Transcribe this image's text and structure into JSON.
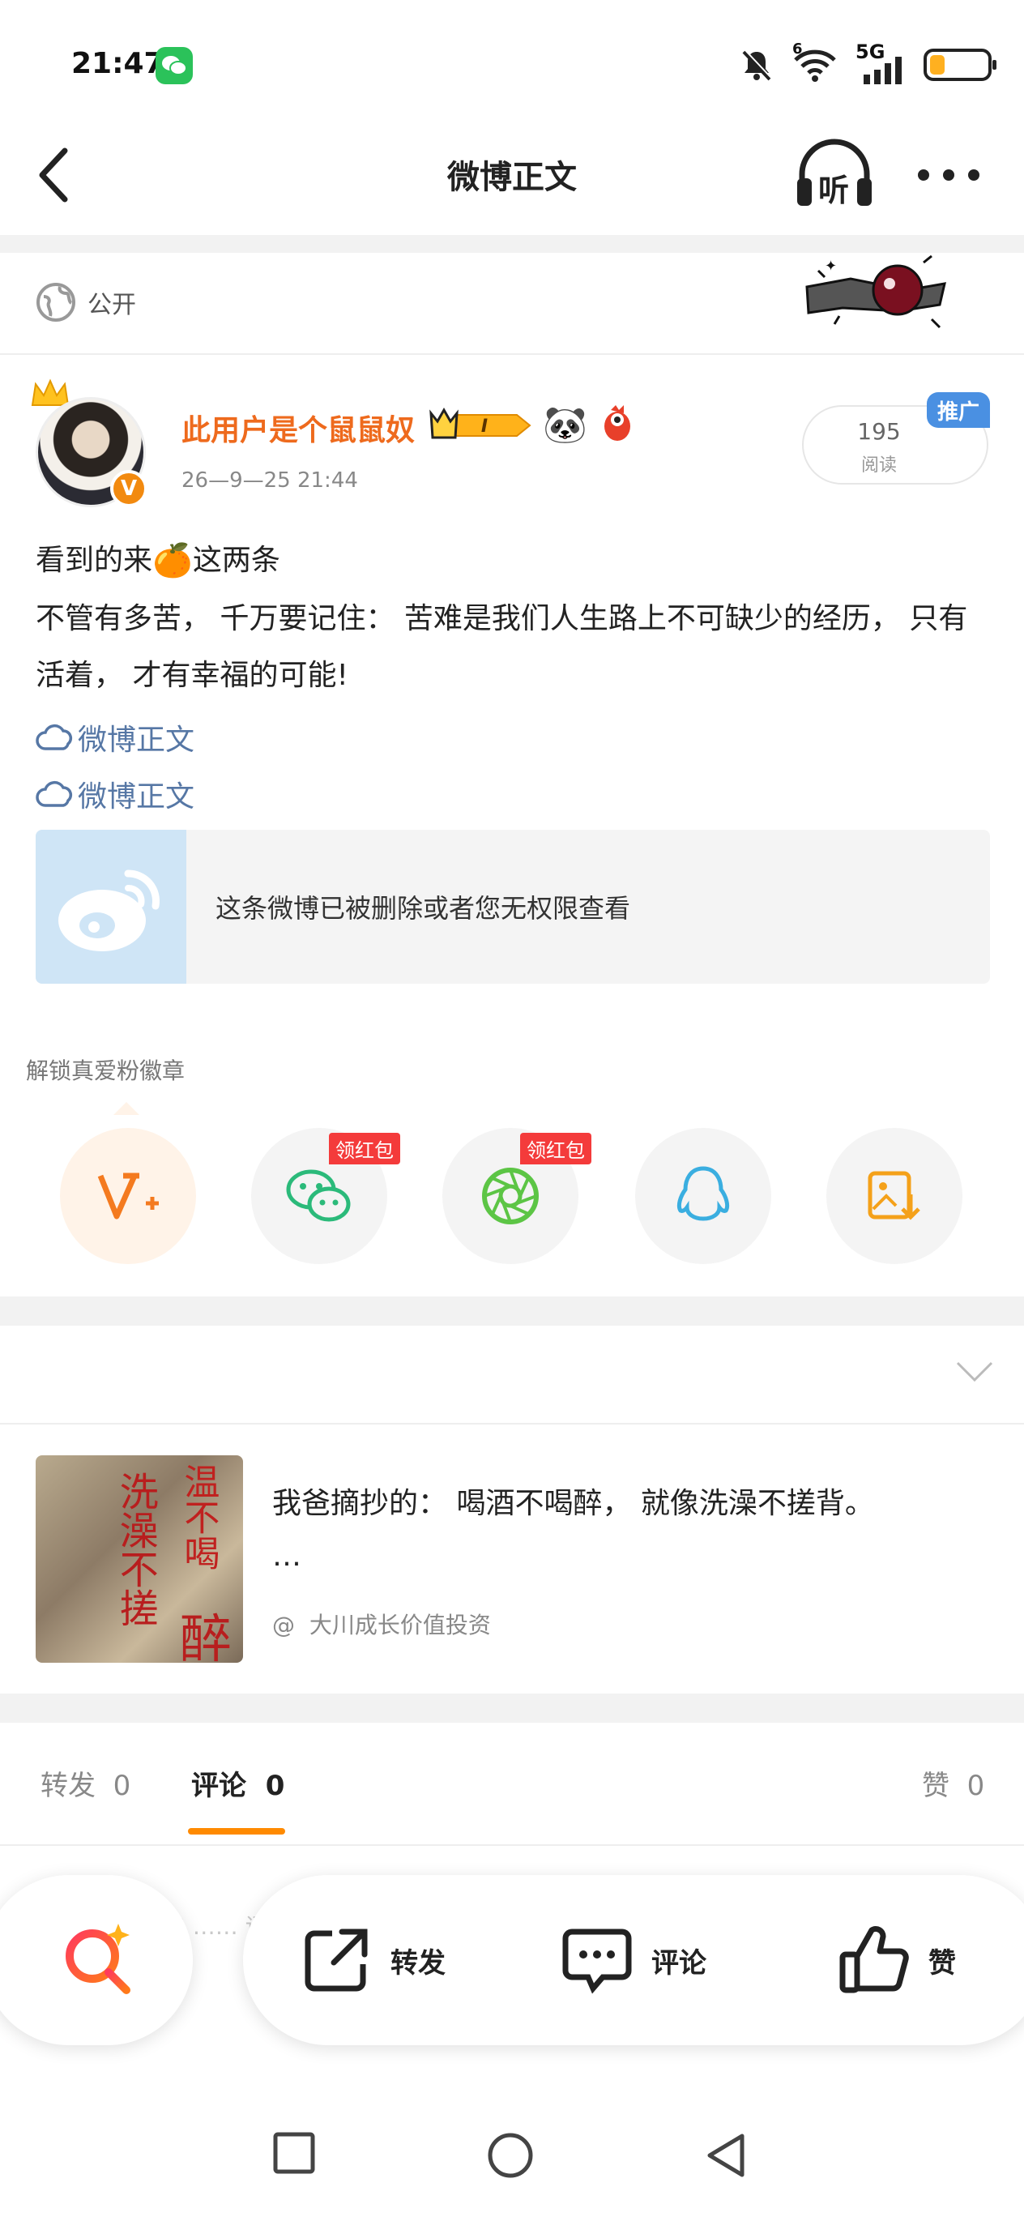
{
  "status_bar": {
    "time": "21:47",
    "network": "5G",
    "wifi_sub": "6"
  },
  "nav": {
    "title": "微博正文",
    "listen_label": "听"
  },
  "visibility": {
    "label": "公开"
  },
  "author": {
    "name": "此用户是个鼠鼠奴",
    "time": "26—9—25  21:44",
    "verified": "V",
    "level_badge": "I"
  },
  "reads": {
    "count": "195",
    "label": "阅读",
    "promo": "推广"
  },
  "post": {
    "line1_a": "看到的来",
    "line1_emoji": "🍊",
    "line1_b": "这两条",
    "line2": "不管有多苦， 千万要记住： 苦难是我们人生路上不可缺少的经历， 只有",
    "line3": "活着， 才有幸福的可能!",
    "links": [
      "微博正文",
      "微博正文"
    ]
  },
  "deleted_card": {
    "text": "这条微博已被删除或者您无权限查看"
  },
  "unlock": {
    "title": "解锁真爱粉徽章",
    "red_packet": "领红包"
  },
  "recommend": {
    "text": "我爸摘抄的： 喝酒不喝醉， 就像洗澡不搓背。",
    "ellipsis": "…",
    "at": "@",
    "author": "大川成长价值投资",
    "image_chars": [
      "温不喝",
      "洗澡不搓",
      "醉"
    ]
  },
  "tabs": {
    "repost": "转发",
    "repost_count": "0",
    "comment": "评论",
    "comment_count": "0",
    "like": "赞",
    "like_count": "0"
  },
  "hint": "…… 意攻击 …… 评论 …… 次数超",
  "actions": {
    "repost": "转发",
    "comment": "评论",
    "like": "赞"
  },
  "colors": {
    "accent": "#ff8a00",
    "name": "#ee6a1d",
    "link": "#5677a5",
    "promo": "#4a90e2",
    "red_tag": "#f43b3b"
  }
}
